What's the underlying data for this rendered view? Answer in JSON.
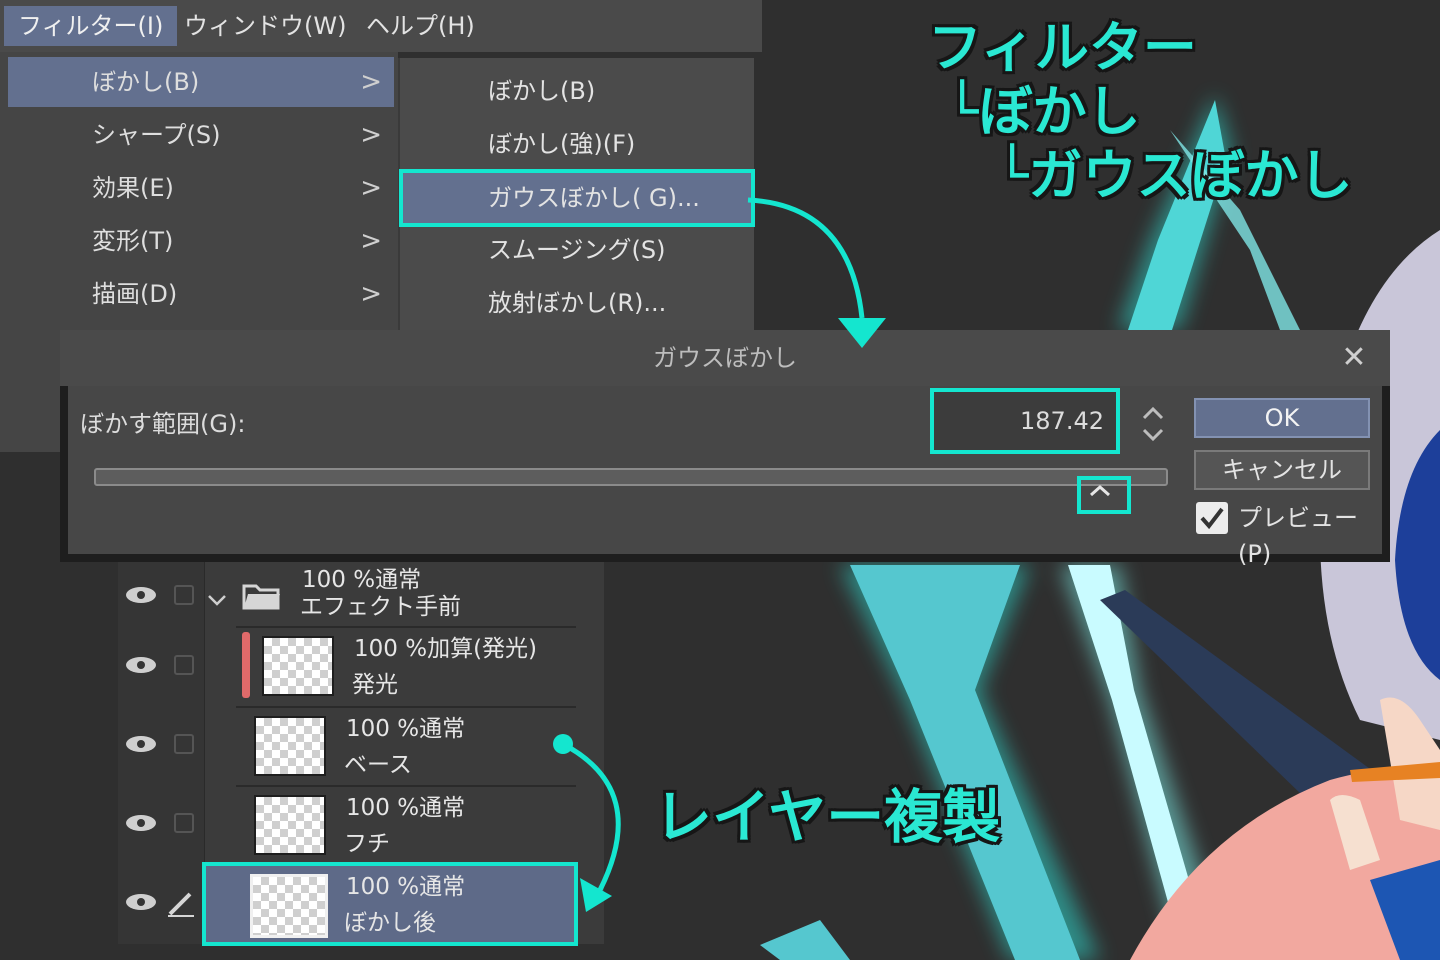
{
  "colors": {
    "accent": "#14e6cf",
    "menu_highlight": "#63708f",
    "annotation": "#2ae8d3"
  },
  "menubar": {
    "items": [
      {
        "label": "フィルター(I)"
      },
      {
        "label": "ウィンドウ(W)"
      },
      {
        "label": "ヘルプ(H)"
      }
    ]
  },
  "filter_menu": {
    "items": [
      {
        "label": "ぼかし(B)"
      },
      {
        "label": "シャープ(S)"
      },
      {
        "label": "効果(E)"
      },
      {
        "label": "変形(T)"
      },
      {
        "label": "描画(D)"
      }
    ],
    "chevron": ">"
  },
  "blur_submenu": {
    "items": [
      {
        "label": "ぼかし(B)"
      },
      {
        "label": "ぼかし(強)(F)"
      },
      {
        "label": "ガウスぼかし( G)..."
      },
      {
        "label": "スムージング(S)"
      },
      {
        "label": "放射ぼかし(R)..."
      }
    ]
  },
  "dialog": {
    "title": "ガウスぼかし",
    "close": "✕",
    "blur_range_label": "ぼかす範囲(G):",
    "blur_range_value": "187.42",
    "slider_level": 0.94,
    "ok_label": "OK",
    "cancel_label": "キャンセル",
    "preview_label": "プレビュー(P)",
    "preview_checked": true
  },
  "layers": {
    "folder": {
      "line1": "100 %通常",
      "line2": "エフェクト手前"
    },
    "items": [
      {
        "mode": "100 %加算(発光)",
        "name": "発光"
      },
      {
        "mode": "100 %通常",
        "name": "ベース"
      },
      {
        "mode": "100 %通常",
        "name": "フチ"
      },
      {
        "mode": "100 %通常",
        "name": "ぼかし後"
      }
    ]
  },
  "annotations": {
    "path_line1": "フィルター",
    "path_line2": "└ぼかし",
    "path_line3": "└ガウスぼかし",
    "duplicate_note": "レイヤー複製"
  }
}
